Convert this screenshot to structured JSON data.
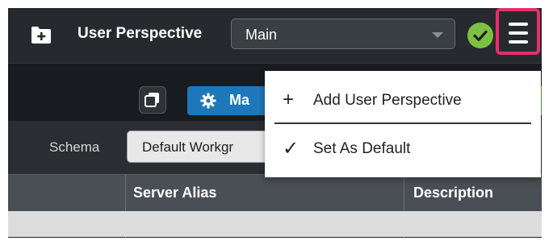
{
  "header": {
    "perspective_label": "User Perspective",
    "perspective_select": {
      "value": "Main"
    },
    "icons": {
      "folder": "folder-plus-icon",
      "status": "check-circle-icon",
      "menu": "hamburger-menu-icon"
    }
  },
  "toolbar": {
    "primary_button_label": "Ma",
    "secondary_button_label": ":"
  },
  "filter": {
    "schema_label": "Schema",
    "schema_value": "Default Workgr"
  },
  "table": {
    "columns": [
      "Server Alias",
      "Description"
    ]
  },
  "menu": {
    "items": [
      {
        "icon": "+",
        "label": "Add User Perspective"
      },
      {
        "icon": "✓",
        "label": "Set As Default"
      }
    ]
  },
  "colors": {
    "accent_highlight": "#e7306a",
    "status_green": "#7cc142",
    "primary_blue": "#1e77b9"
  }
}
